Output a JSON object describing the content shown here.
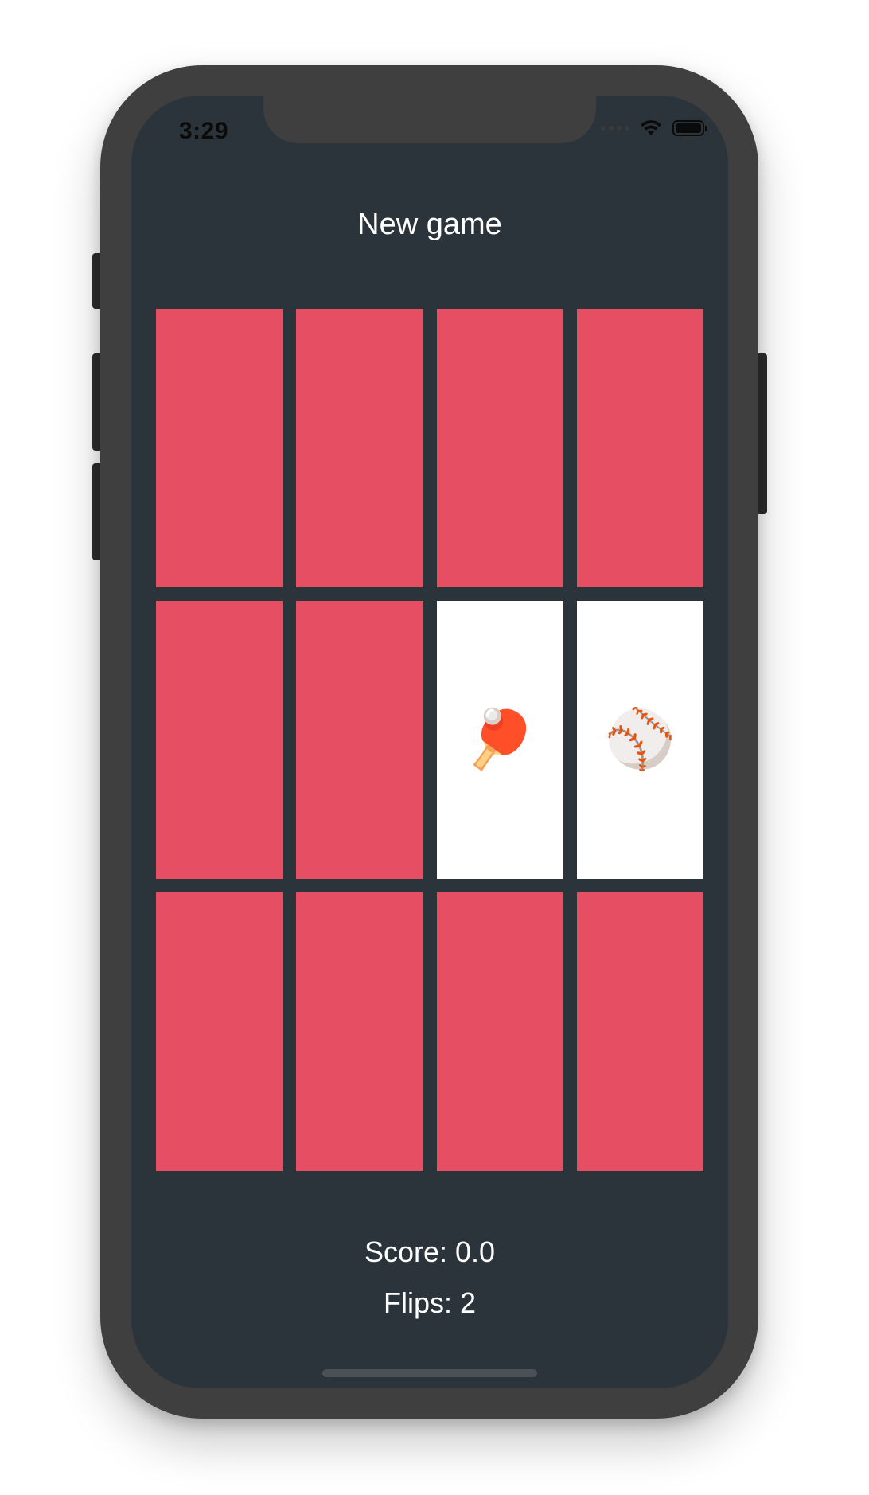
{
  "status_bar": {
    "time": "3:29",
    "icons": [
      "signal-dots-icon",
      "wifi-icon",
      "battery-icon"
    ]
  },
  "header": {
    "new_game_label": "New game"
  },
  "colors": {
    "background": "#2c343b",
    "card_back": "#e54e63",
    "card_face": "#ffffff",
    "text": "#ffffff"
  },
  "cards": [
    {
      "face_up": false,
      "emoji": ""
    },
    {
      "face_up": false,
      "emoji": ""
    },
    {
      "face_up": false,
      "emoji": ""
    },
    {
      "face_up": false,
      "emoji": ""
    },
    {
      "face_up": false,
      "emoji": ""
    },
    {
      "face_up": false,
      "emoji": ""
    },
    {
      "face_up": true,
      "emoji": "🏓"
    },
    {
      "face_up": true,
      "emoji": "⚾"
    },
    {
      "face_up": false,
      "emoji": ""
    },
    {
      "face_up": false,
      "emoji": ""
    },
    {
      "face_up": false,
      "emoji": ""
    },
    {
      "face_up": false,
      "emoji": ""
    }
  ],
  "footer": {
    "score_label": "Score: 0.0",
    "flips_label": "Flips: 2"
  }
}
